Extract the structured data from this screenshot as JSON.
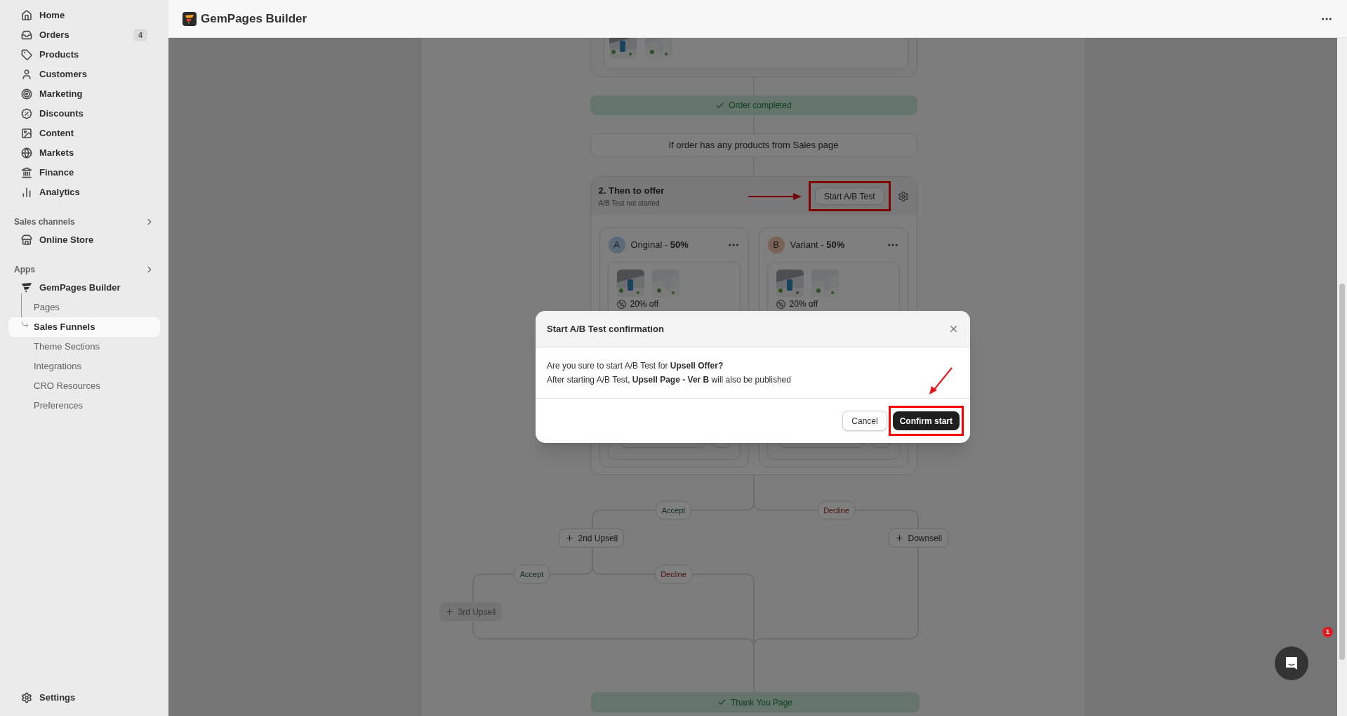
{
  "sidebar": {
    "items": [
      {
        "label": "Home"
      },
      {
        "label": "Orders",
        "badge": "4"
      },
      {
        "label": "Products"
      },
      {
        "label": "Customers"
      },
      {
        "label": "Marketing"
      },
      {
        "label": "Discounts"
      },
      {
        "label": "Content"
      },
      {
        "label": "Markets"
      },
      {
        "label": "Finance"
      },
      {
        "label": "Analytics"
      }
    ],
    "sales_channels": {
      "label": "Sales channels",
      "items": [
        {
          "label": "Online Store"
        }
      ]
    },
    "apps": {
      "label": "Apps",
      "app": {
        "label": "GemPages Builder",
        "children": [
          {
            "label": "Pages",
            "selected": false
          },
          {
            "label": "Sales Funnels",
            "selected": true
          },
          {
            "label": "Theme Sections",
            "selected": false
          },
          {
            "label": "Integrations",
            "selected": false
          },
          {
            "label": "CRO Resources",
            "selected": false
          },
          {
            "label": "Preferences",
            "selected": false
          }
        ]
      }
    },
    "settings": "Settings"
  },
  "topbar": {
    "title": "GemPages Builder"
  },
  "funnel": {
    "order_completed": "Order completed",
    "condition": "If order has any products from Sales page",
    "offer": {
      "title": "2. Then to offer",
      "status": "A/B Test not started",
      "start_button": "Start A/B Test",
      "variants": [
        {
          "letter": "A",
          "name": "Original - **50%**",
          "color": "#5b6a79",
          "discount": "20% off"
        },
        {
          "letter": "B",
          "name": "Variant - **50%**",
          "color": "#7b6257",
          "discount": "20% off"
        }
      ]
    },
    "branches": [
      {
        "label": "Accept",
        "kind": "accept"
      },
      {
        "label": "Decline",
        "kind": "decline"
      },
      {
        "label": "Accept",
        "kind": "accept"
      },
      {
        "label": "Decline",
        "kind": "decline"
      }
    ],
    "nodes": [
      {
        "label": "2nd Upsell",
        "disabled": false
      },
      {
        "label": "Downsell",
        "disabled": false
      },
      {
        "label": "3rd Upsell",
        "disabled": true
      }
    ],
    "thank_you": "Thank You Page"
  },
  "modal": {
    "title": "Start A/B Test confirmation",
    "lines": [
      "Are you sure to start A/B Test for **Upsell Offer?**",
      "After starting A/B Test, **Upsell Page - Ver B** will also be published"
    ],
    "cancel": "Cancel",
    "confirm": "Confirm start"
  },
  "chat": {
    "badge": "1"
  }
}
